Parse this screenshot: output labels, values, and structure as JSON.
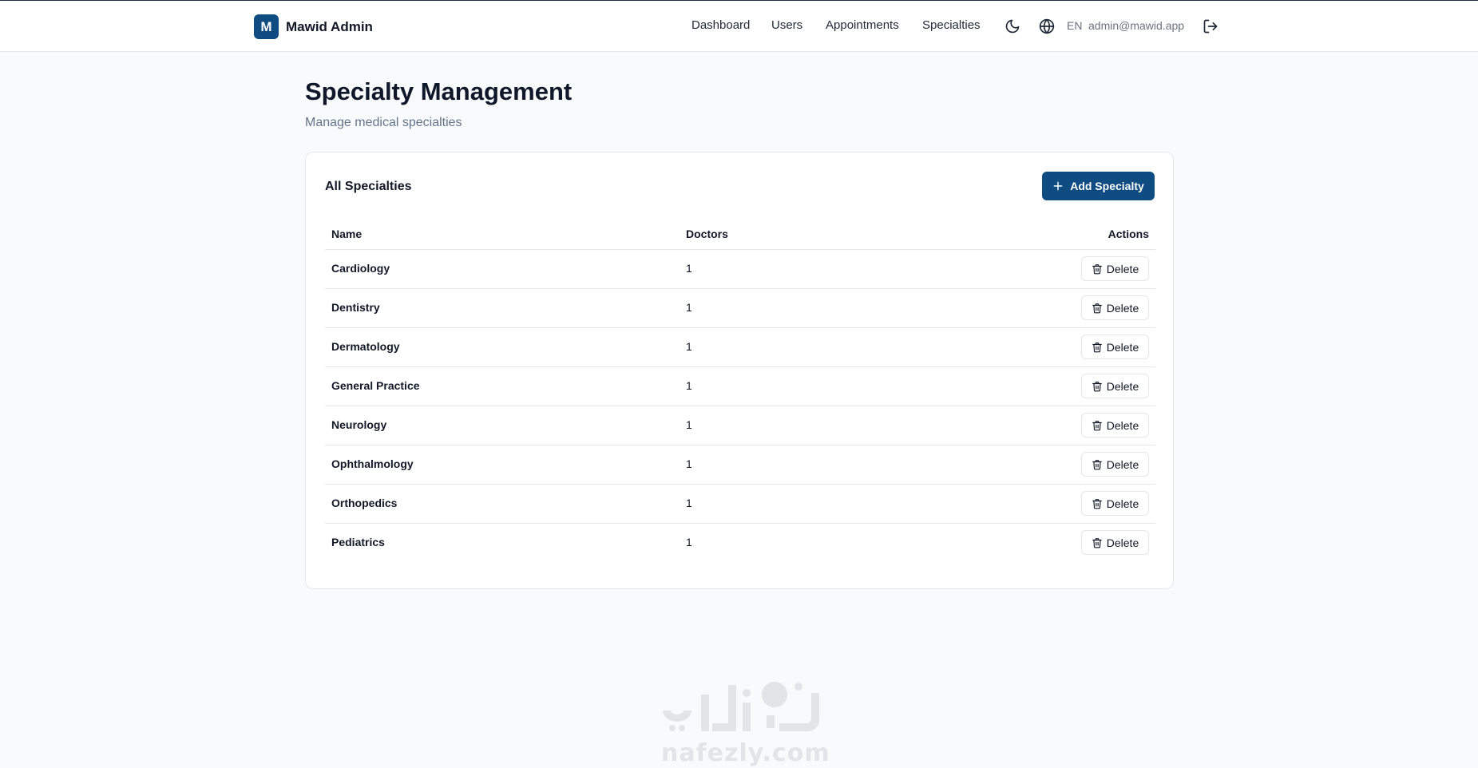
{
  "app": {
    "logo_letter": "M",
    "title": "Mawid Admin"
  },
  "nav": {
    "links": [
      {
        "label": "Dashboard"
      },
      {
        "label": "Users"
      },
      {
        "label": "Appointments"
      },
      {
        "label": "Specialties"
      }
    ],
    "theme_icon": "moon-icon",
    "language_icon": "globe-icon",
    "language": "EN",
    "user_email": "admin@mawid.app",
    "logout_icon": "logout-icon"
  },
  "page": {
    "title": "Specialty Management",
    "subtitle": "Manage medical specialties"
  },
  "card": {
    "title": "All Specialties",
    "add_button_label": "Add Specialty",
    "columns": {
      "name": "Name",
      "doctors": "Doctors",
      "actions": "Actions"
    },
    "rows": [
      {
        "name": "Cardiology",
        "doctors": "1",
        "action": "Delete"
      },
      {
        "name": "Dentistry",
        "doctors": "1",
        "action": "Delete"
      },
      {
        "name": "Dermatology",
        "doctors": "1",
        "action": "Delete"
      },
      {
        "name": "General Practice",
        "doctors": "1",
        "action": "Delete"
      },
      {
        "name": "Neurology",
        "doctors": "1",
        "action": "Delete"
      },
      {
        "name": "Ophthalmology",
        "doctors": "1",
        "action": "Delete"
      },
      {
        "name": "Orthopedics",
        "doctors": "1",
        "action": "Delete"
      },
      {
        "name": "Pediatrics",
        "doctors": "1",
        "action": "Delete"
      }
    ]
  },
  "watermark": {
    "arabic": "نفذلي",
    "latin": "nafezly.com"
  },
  "colors": {
    "primary": "#0f4c81",
    "background": "#f8fafc",
    "text": "#0f172a",
    "muted": "#64748b",
    "border": "#e5e7eb"
  }
}
